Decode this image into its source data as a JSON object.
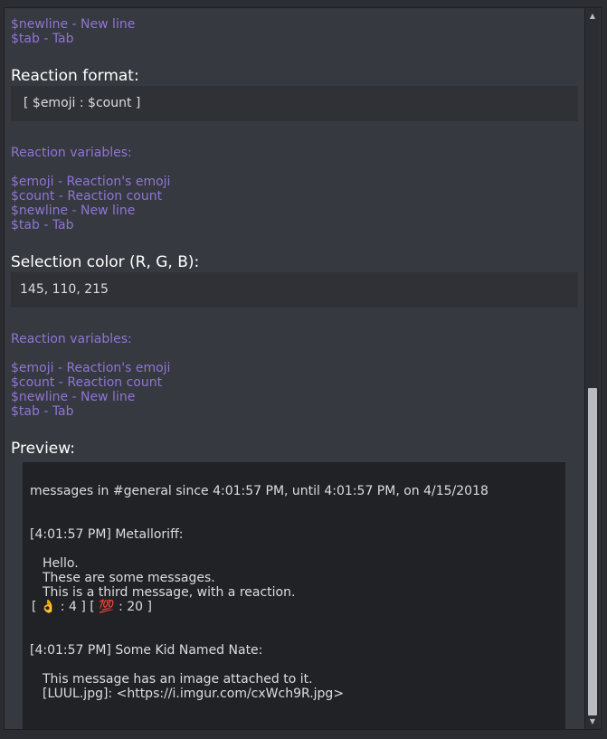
{
  "message_vars_tail": [
    "$newline - New line",
    "$tab - Tab"
  ],
  "reaction_format": {
    "heading": "Reaction format:",
    "value": "[ $emoji : $count ]"
  },
  "reaction_variables_1": {
    "title": "Reaction variables:",
    "lines": [
      "$emoji - Reaction's emoji",
      "$count - Reaction count",
      "$newline - New line",
      "$tab - Tab"
    ]
  },
  "selection_color": {
    "heading": "Selection color (R, G, B):",
    "value": "145, 110, 215"
  },
  "reaction_variables_2": {
    "title": "Reaction variables:",
    "lines": [
      "$emoji - Reaction's emoji",
      "$count - Reaction count",
      "$newline - New line",
      "$tab - Tab"
    ]
  },
  "preview": {
    "heading": "Preview:",
    "header_line": "messages in #general since 4:01:57 PM, until 4:01:57 PM, on 4/15/2018",
    "messages": [
      {
        "author_line": "[4:01:57 PM] Metalloriff:",
        "lines": [
          "Hello.",
          "These are some messages.",
          "This is a third message, with a reaction."
        ],
        "reactions": [
          {
            "emoji": "👌",
            "count": "4"
          },
          {
            "emoji": "💯",
            "count": "20"
          }
        ]
      },
      {
        "author_line": "[4:01:57 PM] Some Kid Named Nate:",
        "lines": [
          "This message has an image attached to it.",
          "[LUUL.jpg]: <https://i.imgur.com/cxWch9R.jpg>"
        ]
      }
    ]
  },
  "scrollbar": {
    "up_icon": "triangle-up",
    "down_icon": "triangle-down"
  },
  "colors": {
    "accent": "#8f76d4",
    "background": "#36393f",
    "field": "#2f3136",
    "preview_bg": "#202225"
  }
}
